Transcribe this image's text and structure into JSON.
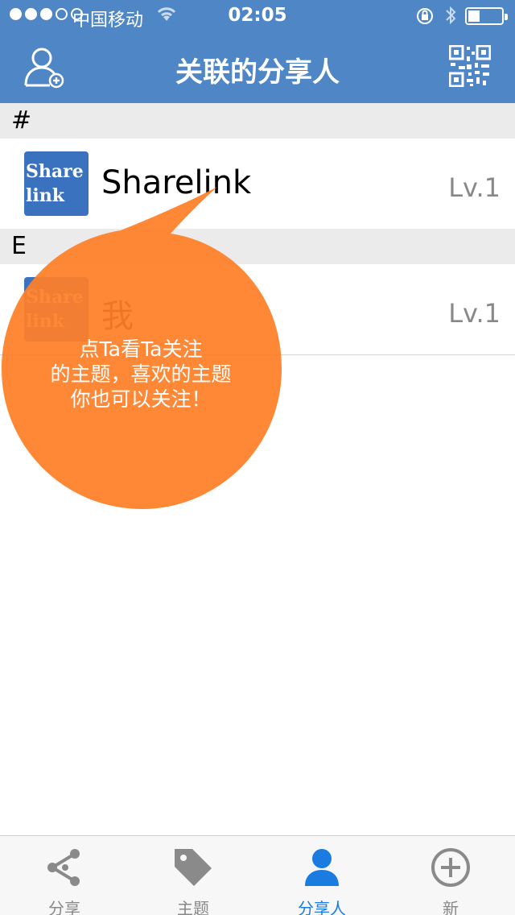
{
  "status_bar": {
    "carrier": "中国移动",
    "time": "02:05"
  },
  "header": {
    "title": "关联的分享人"
  },
  "sections": [
    {
      "letter": "#",
      "rows": [
        {
          "avatar_line1": "Share",
          "avatar_line2": "link",
          "name": "Sharelink",
          "level": "Lv.1"
        }
      ]
    },
    {
      "letter": "E",
      "rows": [
        {
          "avatar_line1": "Share",
          "avatar_line2": "link",
          "name": "我",
          "level": "Lv.1"
        }
      ]
    }
  ],
  "tooltip": {
    "line1": "点Ta看Ta关注",
    "line2": "的主题，喜欢的主题",
    "line3": "你也可以关注！"
  },
  "tabs": [
    {
      "label": "分享",
      "icon": "share-icon",
      "active": false
    },
    {
      "label": "主题",
      "icon": "tag-icon",
      "active": false
    },
    {
      "label": "分享人",
      "icon": "person-icon",
      "active": true
    },
    {
      "label": "新",
      "icon": "plus-circle-icon",
      "active": false
    }
  ],
  "colors": {
    "header": "#4f86c6",
    "tooltip": "#ff7f27",
    "active_tab": "#1a7ce0"
  }
}
